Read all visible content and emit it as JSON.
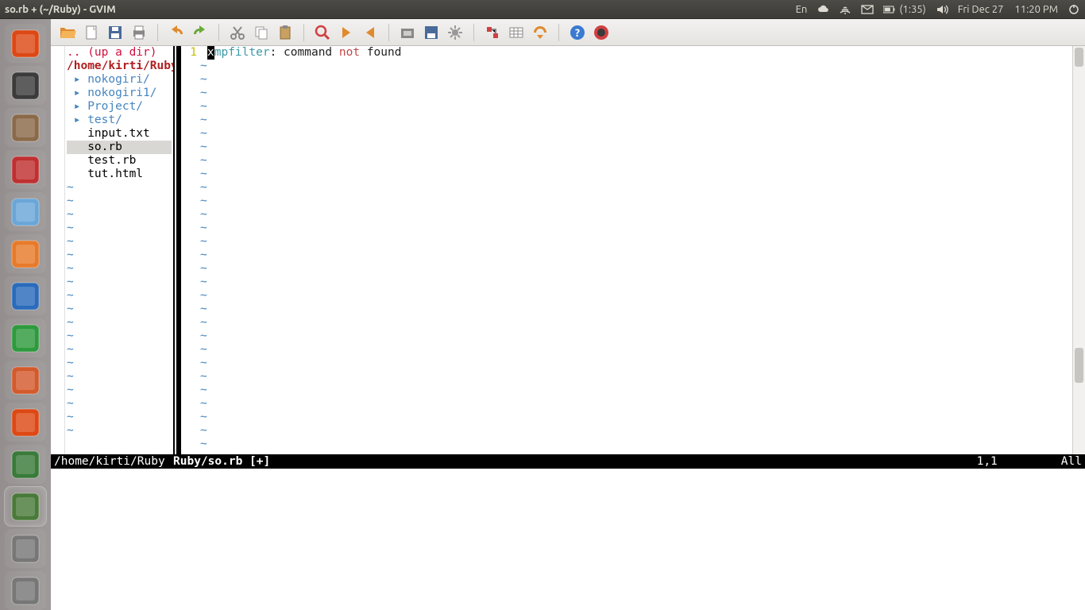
{
  "menubar": {
    "title": "so.rb + (~/Ruby) - GVIM",
    "lang": "En",
    "battery": "(1:35)",
    "date": "Fri Dec 27",
    "time": "11:20 PM"
  },
  "launcher": {
    "items": [
      {
        "name": "dash-icon",
        "color": "#dd4814"
      },
      {
        "name": "sublime-icon",
        "color": "#3b3b3b"
      },
      {
        "name": "files-icon",
        "color": "#8a6a4a"
      },
      {
        "name": "app-icon",
        "color": "#c03030"
      },
      {
        "name": "chromium-icon",
        "color": "#6aa6d8"
      },
      {
        "name": "firefox-icon",
        "color": "#e77a2a"
      },
      {
        "name": "writer-icon",
        "color": "#2a6bbb"
      },
      {
        "name": "calc-icon",
        "color": "#2e9a3d"
      },
      {
        "name": "impress-icon",
        "color": "#d35a2c"
      },
      {
        "name": "software-icon",
        "color": "#dd4814"
      },
      {
        "name": "maps-icon",
        "color": "#3a7a3a"
      },
      {
        "name": "gvim-icon",
        "color": "#4a7a3a"
      },
      {
        "name": "stack-icon-1",
        "color": "#777"
      },
      {
        "name": "stack-icon-2",
        "color": "#777"
      }
    ]
  },
  "toolbar": {
    "groups": [
      [
        "open-icon",
        "new-icon",
        "save-icon",
        "print-icon"
      ],
      [
        "undo-icon",
        "redo-icon"
      ],
      [
        "cut-icon",
        "copy-icon",
        "paste-icon"
      ],
      [
        "find-icon",
        "next-icon",
        "prev-icon"
      ],
      [
        "session-load-icon",
        "session-save-icon",
        "settings-icon"
      ],
      [
        "make-icon",
        "tags-icon",
        "jump-icon"
      ],
      [
        "help-icon",
        "bug-icon"
      ]
    ]
  },
  "tree": {
    "up": ".. (up a dir)",
    "cwd": "/home/kirti/Ruby/",
    "dirs": [
      "nokogiri/",
      "nokogiri1/",
      "Project/",
      "test/"
    ],
    "files": [
      "input.txt",
      "so.rb",
      "test.rb",
      "tut.html"
    ],
    "selected": "so.rb"
  },
  "editor": {
    "line_no": "1",
    "cursor_char": "x",
    "tok1": "mpfilter",
    "colon": ":",
    "tok2": " command ",
    "tok_not": "not",
    "tok3": " found"
  },
  "status": {
    "left": "/home/kirti/Ruby",
    "file": "Ruby/so.rb [+]",
    "pos": "1,1",
    "pct": "All"
  }
}
